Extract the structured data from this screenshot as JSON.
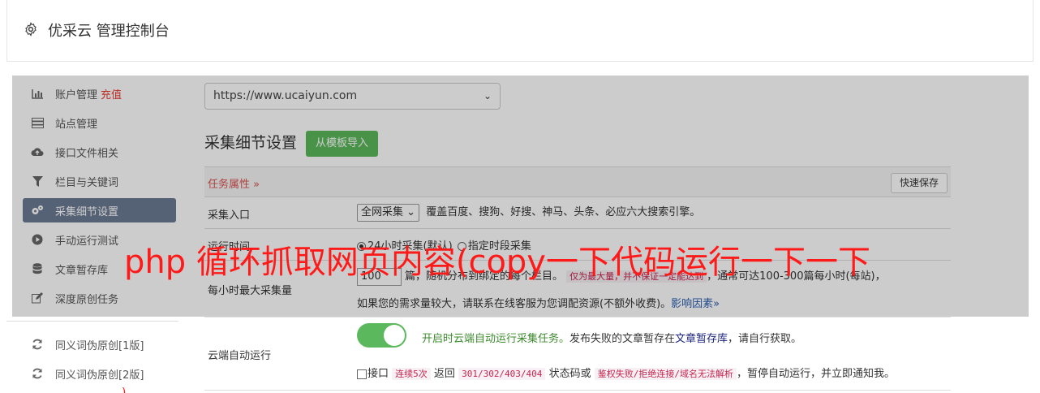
{
  "header": {
    "title": "优采云 管理控制台"
  },
  "sidebar": {
    "items": [
      {
        "label": "账户管理",
        "badge": "充值",
        "icon": "bar-chart-icon"
      },
      {
        "label": "站点管理",
        "icon": "server-icon"
      },
      {
        "label": "接口文件相关",
        "icon": "cloud-upload-icon"
      },
      {
        "label": "栏目与关键词",
        "icon": "filter-icon"
      },
      {
        "label": "采集细节设置",
        "icon": "gears-icon",
        "active": true
      },
      {
        "label": "手动运行测试",
        "icon": "play-circle-icon"
      },
      {
        "label": "文章暂存库",
        "icon": "database-icon"
      },
      {
        "label": "深度原创任务",
        "icon": "edit-icon"
      },
      {
        "label": "同义词伪原创[1版]",
        "icon": "refresh-icon"
      },
      {
        "label": "同义词伪原创[2版]",
        "icon": "refresh-icon"
      }
    ]
  },
  "main": {
    "site_select": "https://www.ucaiyun.com",
    "section_title": "采集细节设置",
    "template_button": "从模板导入",
    "task_attr_label": "任务属性 »",
    "quick_save": "快速保存",
    "rows": {
      "entry": {
        "label": "采集入口",
        "select": "全网采集",
        "desc": "覆盖百度、搜狗、好搜、神马、头条、必应六大搜索引擎。"
      },
      "time": {
        "label": "运行时间",
        "opt1": "24小时采集(默认)",
        "opt2": "指定时段采集"
      },
      "max_per_hour": {
        "label": "每小时最大采集量",
        "value": "100",
        "text1": "篇，随机分布到绑定的每个栏目。",
        "code": "仅为最大量，并不保证一定能达到",
        "text2": "，通常可达100-300篇每小时(每站)，",
        "text3": "如果您的需求量较大，请联系在线客服为您调配资源(不额外收费)。",
        "link": "影响因素»"
      },
      "cloud": {
        "label": "云端自动运行",
        "toggle_on": true,
        "line1_green": "开启时云端自动运行采集任务。",
        "line1_text": "发布失败的文章暂存在",
        "line1_link": "文章暂存库",
        "line1_tail": "，请自行获取。",
        "cb_label": "接口",
        "code1": "连续5次",
        "text_a": "返回",
        "code2": "301/302/403/404",
        "text_b": "状态码或",
        "code3": "鉴权失败/拒绝连接/域名无法解析",
        "text_c": "，暂停自动运行，并立即通知我。"
      }
    }
  },
  "overlay_text": "php 循环抓取网页内容(copy一下代码运行一下一下",
  "red_mark": ")",
  "colors": {
    "accent_green": "#5cb85c",
    "active_sidebar": "#6b7a92",
    "danger": "#d9534f",
    "overlay_red": "#ff1a1a"
  }
}
